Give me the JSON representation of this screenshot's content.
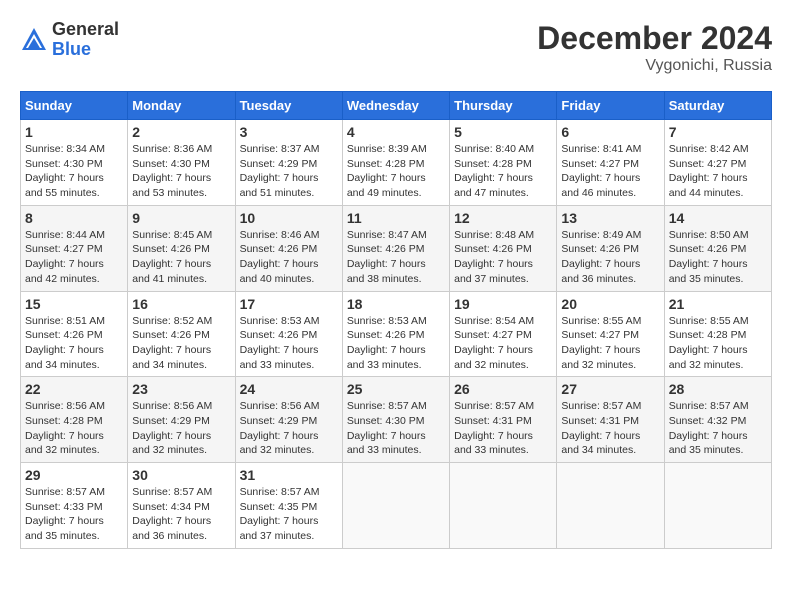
{
  "logo": {
    "general": "General",
    "blue": "Blue"
  },
  "header": {
    "title": "December 2024",
    "location": "Vygonichi, Russia"
  },
  "days_of_week": [
    "Sunday",
    "Monday",
    "Tuesday",
    "Wednesday",
    "Thursday",
    "Friday",
    "Saturday"
  ],
  "weeks": [
    [
      {
        "day": "1",
        "sunrise": "Sunrise: 8:34 AM",
        "sunset": "Sunset: 4:30 PM",
        "daylight": "Daylight: 7 hours and 55 minutes."
      },
      {
        "day": "2",
        "sunrise": "Sunrise: 8:36 AM",
        "sunset": "Sunset: 4:30 PM",
        "daylight": "Daylight: 7 hours and 53 minutes."
      },
      {
        "day": "3",
        "sunrise": "Sunrise: 8:37 AM",
        "sunset": "Sunset: 4:29 PM",
        "daylight": "Daylight: 7 hours and 51 minutes."
      },
      {
        "day": "4",
        "sunrise": "Sunrise: 8:39 AM",
        "sunset": "Sunset: 4:28 PM",
        "daylight": "Daylight: 7 hours and 49 minutes."
      },
      {
        "day": "5",
        "sunrise": "Sunrise: 8:40 AM",
        "sunset": "Sunset: 4:28 PM",
        "daylight": "Daylight: 7 hours and 47 minutes."
      },
      {
        "day": "6",
        "sunrise": "Sunrise: 8:41 AM",
        "sunset": "Sunset: 4:27 PM",
        "daylight": "Daylight: 7 hours and 46 minutes."
      },
      {
        "day": "7",
        "sunrise": "Sunrise: 8:42 AM",
        "sunset": "Sunset: 4:27 PM",
        "daylight": "Daylight: 7 hours and 44 minutes."
      }
    ],
    [
      {
        "day": "8",
        "sunrise": "Sunrise: 8:44 AM",
        "sunset": "Sunset: 4:27 PM",
        "daylight": "Daylight: 7 hours and 42 minutes."
      },
      {
        "day": "9",
        "sunrise": "Sunrise: 8:45 AM",
        "sunset": "Sunset: 4:26 PM",
        "daylight": "Daylight: 7 hours and 41 minutes."
      },
      {
        "day": "10",
        "sunrise": "Sunrise: 8:46 AM",
        "sunset": "Sunset: 4:26 PM",
        "daylight": "Daylight: 7 hours and 40 minutes."
      },
      {
        "day": "11",
        "sunrise": "Sunrise: 8:47 AM",
        "sunset": "Sunset: 4:26 PM",
        "daylight": "Daylight: 7 hours and 38 minutes."
      },
      {
        "day": "12",
        "sunrise": "Sunrise: 8:48 AM",
        "sunset": "Sunset: 4:26 PM",
        "daylight": "Daylight: 7 hours and 37 minutes."
      },
      {
        "day": "13",
        "sunrise": "Sunrise: 8:49 AM",
        "sunset": "Sunset: 4:26 PM",
        "daylight": "Daylight: 7 hours and 36 minutes."
      },
      {
        "day": "14",
        "sunrise": "Sunrise: 8:50 AM",
        "sunset": "Sunset: 4:26 PM",
        "daylight": "Daylight: 7 hours and 35 minutes."
      }
    ],
    [
      {
        "day": "15",
        "sunrise": "Sunrise: 8:51 AM",
        "sunset": "Sunset: 4:26 PM",
        "daylight": "Daylight: 7 hours and 34 minutes."
      },
      {
        "day": "16",
        "sunrise": "Sunrise: 8:52 AM",
        "sunset": "Sunset: 4:26 PM",
        "daylight": "Daylight: 7 hours and 34 minutes."
      },
      {
        "day": "17",
        "sunrise": "Sunrise: 8:53 AM",
        "sunset": "Sunset: 4:26 PM",
        "daylight": "Daylight: 7 hours and 33 minutes."
      },
      {
        "day": "18",
        "sunrise": "Sunrise: 8:53 AM",
        "sunset": "Sunset: 4:26 PM",
        "daylight": "Daylight: 7 hours and 33 minutes."
      },
      {
        "day": "19",
        "sunrise": "Sunrise: 8:54 AM",
        "sunset": "Sunset: 4:27 PM",
        "daylight": "Daylight: 7 hours and 32 minutes."
      },
      {
        "day": "20",
        "sunrise": "Sunrise: 8:55 AM",
        "sunset": "Sunset: 4:27 PM",
        "daylight": "Daylight: 7 hours and 32 minutes."
      },
      {
        "day": "21",
        "sunrise": "Sunrise: 8:55 AM",
        "sunset": "Sunset: 4:28 PM",
        "daylight": "Daylight: 7 hours and 32 minutes."
      }
    ],
    [
      {
        "day": "22",
        "sunrise": "Sunrise: 8:56 AM",
        "sunset": "Sunset: 4:28 PM",
        "daylight": "Daylight: 7 hours and 32 minutes."
      },
      {
        "day": "23",
        "sunrise": "Sunrise: 8:56 AM",
        "sunset": "Sunset: 4:29 PM",
        "daylight": "Daylight: 7 hours and 32 minutes."
      },
      {
        "day": "24",
        "sunrise": "Sunrise: 8:56 AM",
        "sunset": "Sunset: 4:29 PM",
        "daylight": "Daylight: 7 hours and 32 minutes."
      },
      {
        "day": "25",
        "sunrise": "Sunrise: 8:57 AM",
        "sunset": "Sunset: 4:30 PM",
        "daylight": "Daylight: 7 hours and 33 minutes."
      },
      {
        "day": "26",
        "sunrise": "Sunrise: 8:57 AM",
        "sunset": "Sunset: 4:31 PM",
        "daylight": "Daylight: 7 hours and 33 minutes."
      },
      {
        "day": "27",
        "sunrise": "Sunrise: 8:57 AM",
        "sunset": "Sunset: 4:31 PM",
        "daylight": "Daylight: 7 hours and 34 minutes."
      },
      {
        "day": "28",
        "sunrise": "Sunrise: 8:57 AM",
        "sunset": "Sunset: 4:32 PM",
        "daylight": "Daylight: 7 hours and 35 minutes."
      }
    ],
    [
      {
        "day": "29",
        "sunrise": "Sunrise: 8:57 AM",
        "sunset": "Sunset: 4:33 PM",
        "daylight": "Daylight: 7 hours and 35 minutes."
      },
      {
        "day": "30",
        "sunrise": "Sunrise: 8:57 AM",
        "sunset": "Sunset: 4:34 PM",
        "daylight": "Daylight: 7 hours and 36 minutes."
      },
      {
        "day": "31",
        "sunrise": "Sunrise: 8:57 AM",
        "sunset": "Sunset: 4:35 PM",
        "daylight": "Daylight: 7 hours and 37 minutes."
      },
      null,
      null,
      null,
      null
    ]
  ]
}
